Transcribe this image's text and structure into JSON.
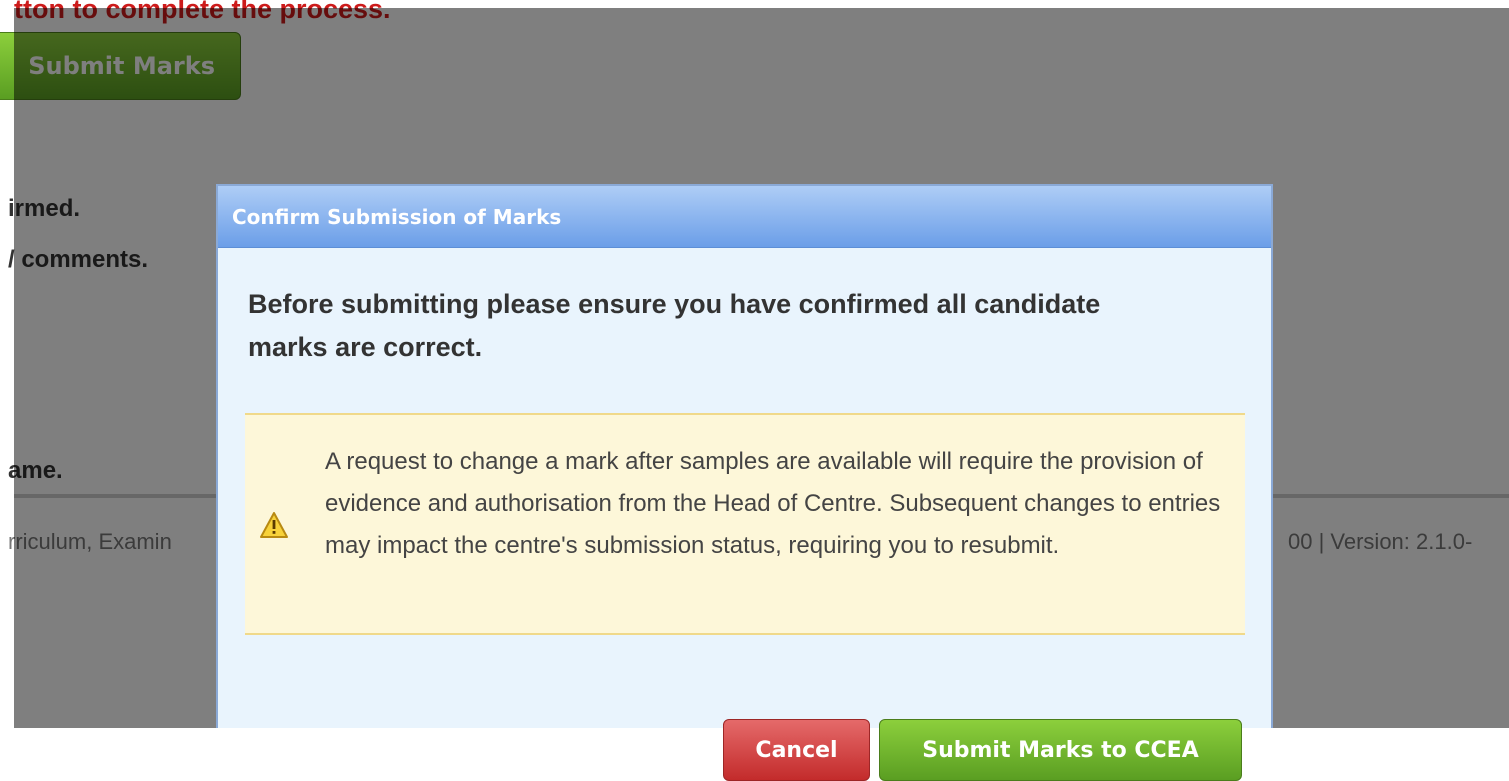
{
  "background": {
    "instruction_text": "tton to complete the process.",
    "submit_button_label": "Submit Marks",
    "lines": [
      "irmed.",
      "/ comments.",
      "ame."
    ],
    "footer_left": "rriculum, Examin",
    "footer_right": "00 | Version: 2.1.0-"
  },
  "dialog": {
    "title": "Confirm Submission of Marks",
    "message": "Before submitting please ensure you have confirmed all candidate marks are correct.",
    "warning": {
      "icon": "warning-icon",
      "text": "A request to change a mark after samples are available will require the provision of evidence and authorisation from the Head of Centre. Subsequent changes to entries may impact the centre's submission status, requiring you to resubmit."
    },
    "buttons": {
      "cancel_label": "Cancel",
      "submit_label": "Submit Marks to CCEA"
    }
  },
  "colors": {
    "instruction_red": "#cc1b1b",
    "submit_green": "#5a9e22",
    "cancel_red": "#c32b2b",
    "dialog_header_blue": "#6b9ee8",
    "warning_bg": "#fdf7d9"
  }
}
